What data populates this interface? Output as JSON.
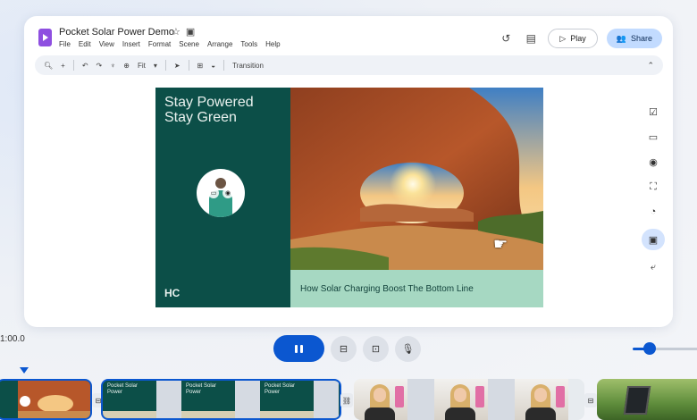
{
  "app": {
    "doc_title": "Pocket Solar Power Demo",
    "menu": [
      "File",
      "Edit",
      "View",
      "Insert",
      "Format",
      "Scene",
      "Arrange",
      "Tools",
      "Help"
    ],
    "play_label": "Play",
    "share_label": "Share",
    "accent_color": "#0b57d0"
  },
  "toolbar": {
    "zoom_label": "Fit",
    "transition_label": "Transition"
  },
  "slide": {
    "title": "Stay Powered\nStay Green",
    "caption": "How Solar Charging Boost The Bottom Line",
    "logo": "HC",
    "background_color": "#0c4f48",
    "caption_color": "#a6d8c2"
  },
  "timeline": {
    "timecode": "1:00.0",
    "clip_title": "Pocket Solar\nPower"
  }
}
